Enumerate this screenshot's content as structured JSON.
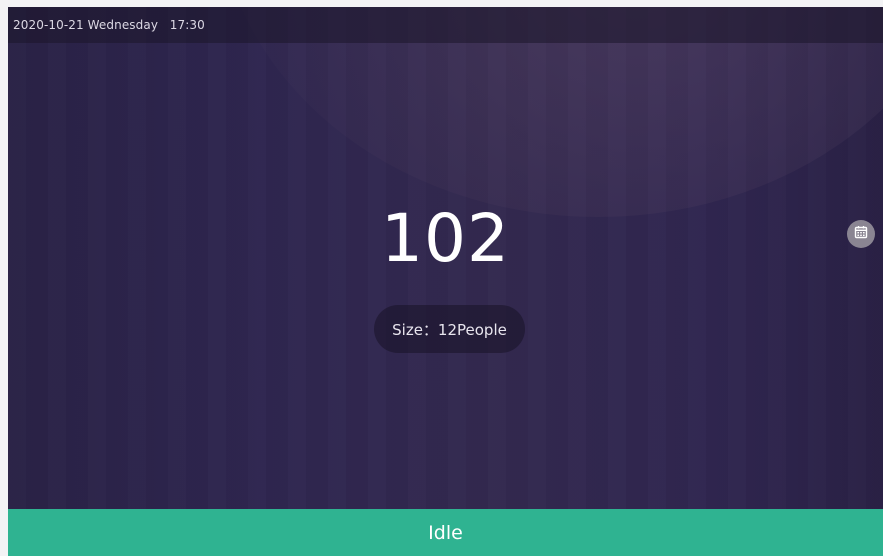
{
  "header": {
    "datetime": "2020-10-21 Wednesday   17:30"
  },
  "room": {
    "number": "102",
    "size_label": "Size：12People"
  },
  "icons": {
    "calendar": "calendar-icon"
  },
  "status": {
    "label": "Idle",
    "color": "#2fb391"
  },
  "colors": {
    "background": "#2f2650",
    "status_bar": "#2fb391"
  }
}
